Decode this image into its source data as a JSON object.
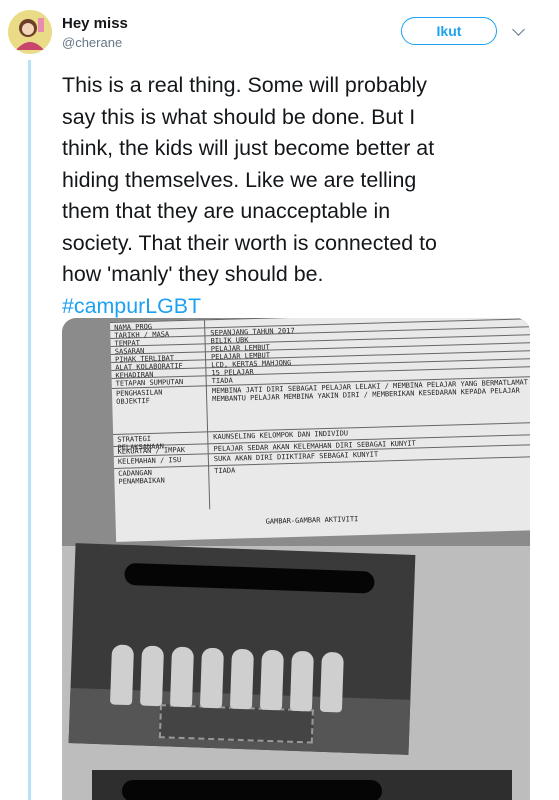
{
  "user": {
    "name": "Hey miss",
    "handle": "@cherane"
  },
  "follow_label": "Ikut",
  "tweet": {
    "lines": [
      "This is a real thing. Some will probably",
      "say this is what should be done. But I",
      "think, the kids will just become better at",
      "hiding themselves. Like we are telling",
      "them that they are unacceptable in",
      "society. That their worth is connected to",
      "how 'manly' they should be."
    ],
    "hashtag": "#campurLGBT"
  },
  "image": {
    "form_rows": [
      {
        "label": "NAMA PROG",
        "value": ""
      },
      {
        "label": "TARIKH / MASA",
        "value": "SEPANJANG TAHUN 2017"
      },
      {
        "label": "TEMPAT",
        "value": "BILIK UBK"
      },
      {
        "label": "SASARAN",
        "value": "PELAJAR LEMBUT"
      },
      {
        "label": "PIHAK TERLIBAT",
        "value": "PELAJAR LEMBUT"
      },
      {
        "label": "ALAT KOLABORATIF",
        "value": "LCD, KERTAS MAHJONG"
      },
      {
        "label": "KEHADIRAN",
        "value": "15 PELAJAR"
      },
      {
        "label": "TETAPAN SUMPUTAN",
        "value": "TIADA"
      },
      {
        "label": "PENGHASILAN OBJEKTIF",
        "value": "MEMBINA JATI DIRI SEBAGAI PELAJAR LELAKI / MEMBINA PELAJAR YANG BERMATLAMAT / MEMBANTU PELAJAR MEMBINA YAKIN DIRI / MEMBERIKAN KESEDARAN KEPADA PELAJAR"
      },
      {
        "label": "STRATEGI PELAKSANAAN",
        "value": "KAUNSELING KELOMPOK DAN INDIVIDU"
      },
      {
        "label": "KEKUATAN / IMPAK",
        "value": "PELAJAR SEDAR AKAN KELEMAHAN DIRI SEBAGAI KUNYIT"
      },
      {
        "label": "KELEMAHAN / ISU",
        "value": "SUKA AKAN DIRI DIIKTIRAF SEBAGAI KUNYIT"
      },
      {
        "label": "CADANGAN PENAMBAIKAN",
        "value": "TIADA"
      }
    ],
    "caption": "GAMBAR-GAMBAR AKTIVITI"
  },
  "colors": {
    "accent": "#1da1f2",
    "thread_line": "#b9e2f7"
  },
  "icons": {
    "more": "chevron-down-icon"
  }
}
